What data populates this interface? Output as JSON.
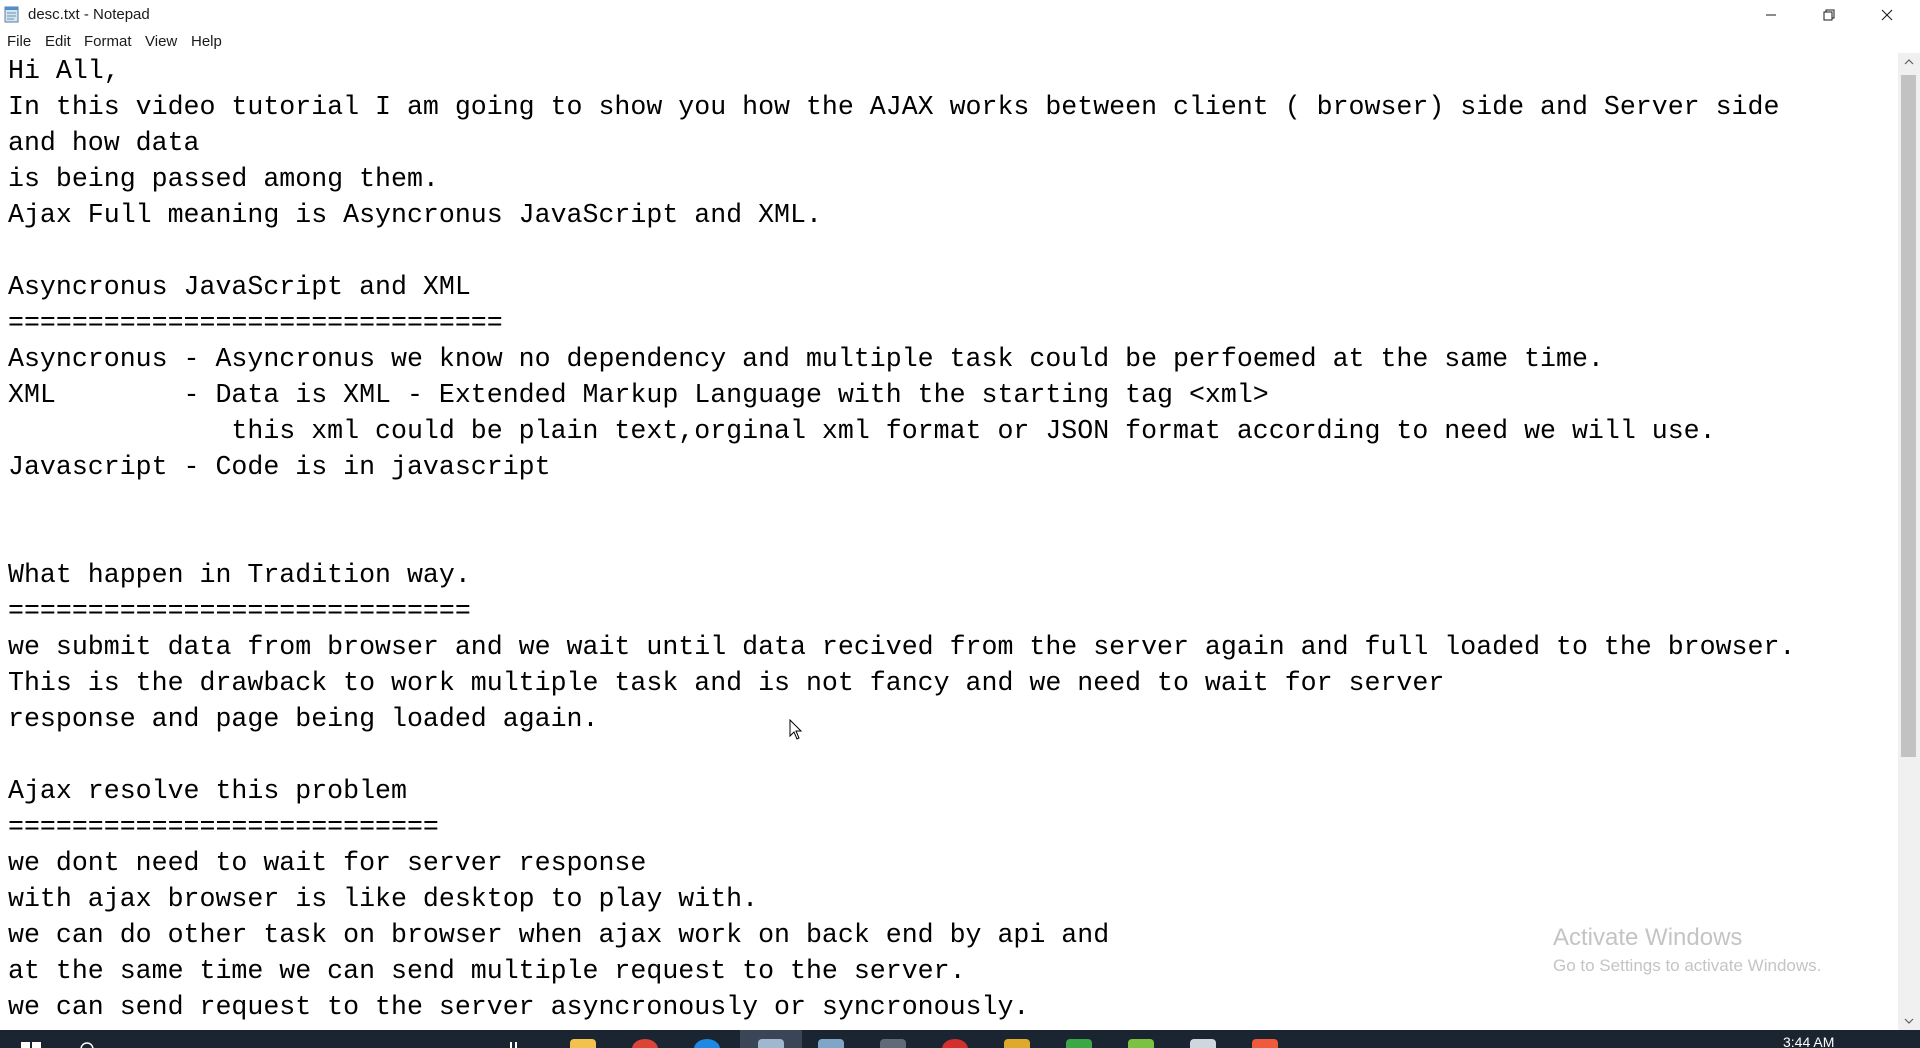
{
  "window": {
    "title": "desc.txt - Notepad"
  },
  "menu": [
    "File",
    "Edit",
    "Format",
    "View",
    "Help"
  ],
  "document": {
    "lines": [
      "Hi All,",
      "In this video tutorial I am going to show you how the AJAX works between client ( browser) side and Server side",
      "and how data",
      "is being passed among them.",
      "Ajax Full meaning is Asyncronus JavaScript and XML.",
      "",
      "Asyncronus JavaScript and XML",
      "===============================",
      "Asyncronus - Asyncronus we know no dependency and multiple task could be perfoemed at the same time.",
      "XML        - Data is XML - Extended Markup Language with the starting tag <xml>",
      "              this xml could be plain text,orginal xml format or JSON format according to need we will use.",
      "Javascript - Code is in javascript",
      "",
      "",
      "What happen in Tradition way.",
      "=============================",
      "we submit data from browser and we wait until data recived from the server again and full loaded to the browser.",
      "This is the drawback to work multiple task and is not fancy and we need to wait for server",
      "response and page being loaded again.",
      "",
      "Ajax resolve this problem",
      "===========================",
      "we dont need to wait for server response",
      "with ajax browser is like desktop to play with.",
      "we can do other task on browser when ajax work on back end by api and",
      "at the same time we can send multiple request to the server.",
      "we can send request to the server asyncronously or syncronously."
    ]
  },
  "watermark": {
    "title": "Activate Windows",
    "subtitle": "Go to Settings to activate Windows."
  },
  "taskbar": {
    "clock": "3:44 AM",
    "icons": [
      "start-icon",
      "search-icon",
      "task-view-icon",
      "file-explorer-icon",
      "chrome-icon",
      "edge-icon",
      "notepad-icon",
      "photos-icon",
      "terminal-icon",
      "opera-icon",
      "folder-icon",
      "console-icon",
      "notepad-plus-icon",
      "tool-icon",
      "app-icon"
    ]
  },
  "colors": {
    "text": "#000000",
    "watermark": "#c4c4c4",
    "taskbar": "#1b2431"
  }
}
